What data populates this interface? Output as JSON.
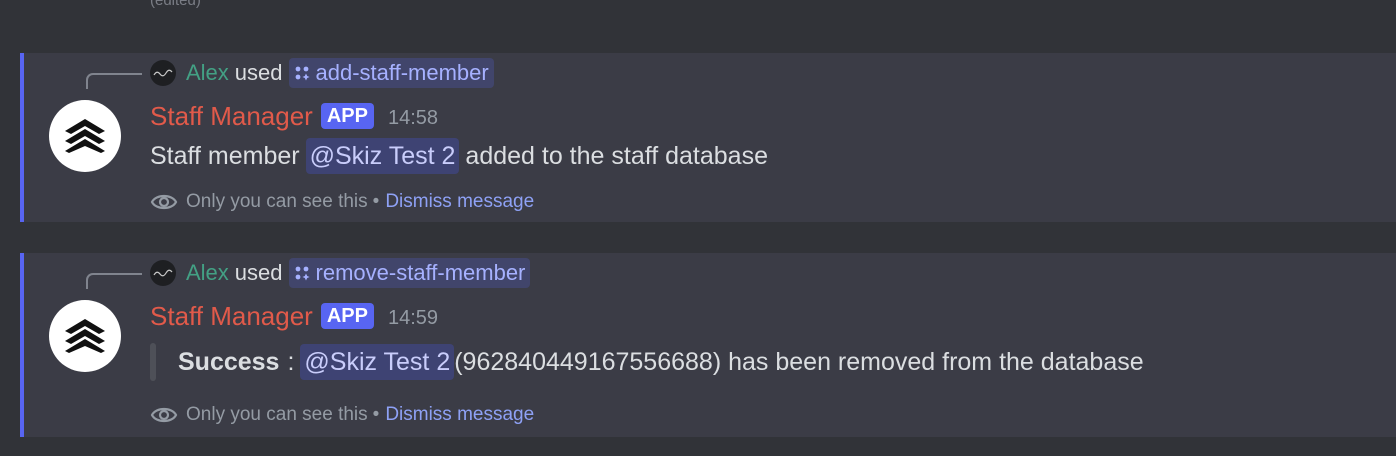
{
  "top_fragment": {
    "edited_label": "(edited)"
  },
  "messages": [
    {
      "reply": {
        "user": "Alex",
        "used_label": "used",
        "command": "add-staff-member"
      },
      "author": "Staff Manager",
      "badge": "APP",
      "time": "14:58",
      "content": {
        "prefix": "Staff member",
        "mention": "@Skiz Test 2",
        "suffix": "added to the staff database"
      },
      "ephemeral": {
        "notice": "Only you can see this",
        "separator": "•",
        "dismiss": "Dismiss message"
      }
    },
    {
      "reply": {
        "user": "Alex",
        "used_label": "used",
        "command": "remove-staff-member"
      },
      "author": "Staff Manager",
      "badge": "APP",
      "time": "14:59",
      "content": {
        "bold": "Success",
        "colon": ":",
        "mention": "@Skiz Test 2",
        "suffix": "(962840449167556688) has been removed from the database"
      },
      "ephemeral": {
        "notice": "Only you can see this",
        "separator": "•",
        "dismiss": "Dismiss message"
      }
    }
  ],
  "colors": {
    "background": "#313338",
    "highlight": "#3b3c46",
    "accent_bar": "#5865f2",
    "bot_name": "#e15a4a",
    "user_name": "#43a084",
    "link": "#8ea1f5",
    "mention_bg": "#3e4373"
  },
  "icons": {
    "command": "slash-command-icon",
    "visibility": "eye-icon",
    "avatar": "staff-manager-chevrons-logo",
    "mini_avatar": "skizzy-logo"
  }
}
